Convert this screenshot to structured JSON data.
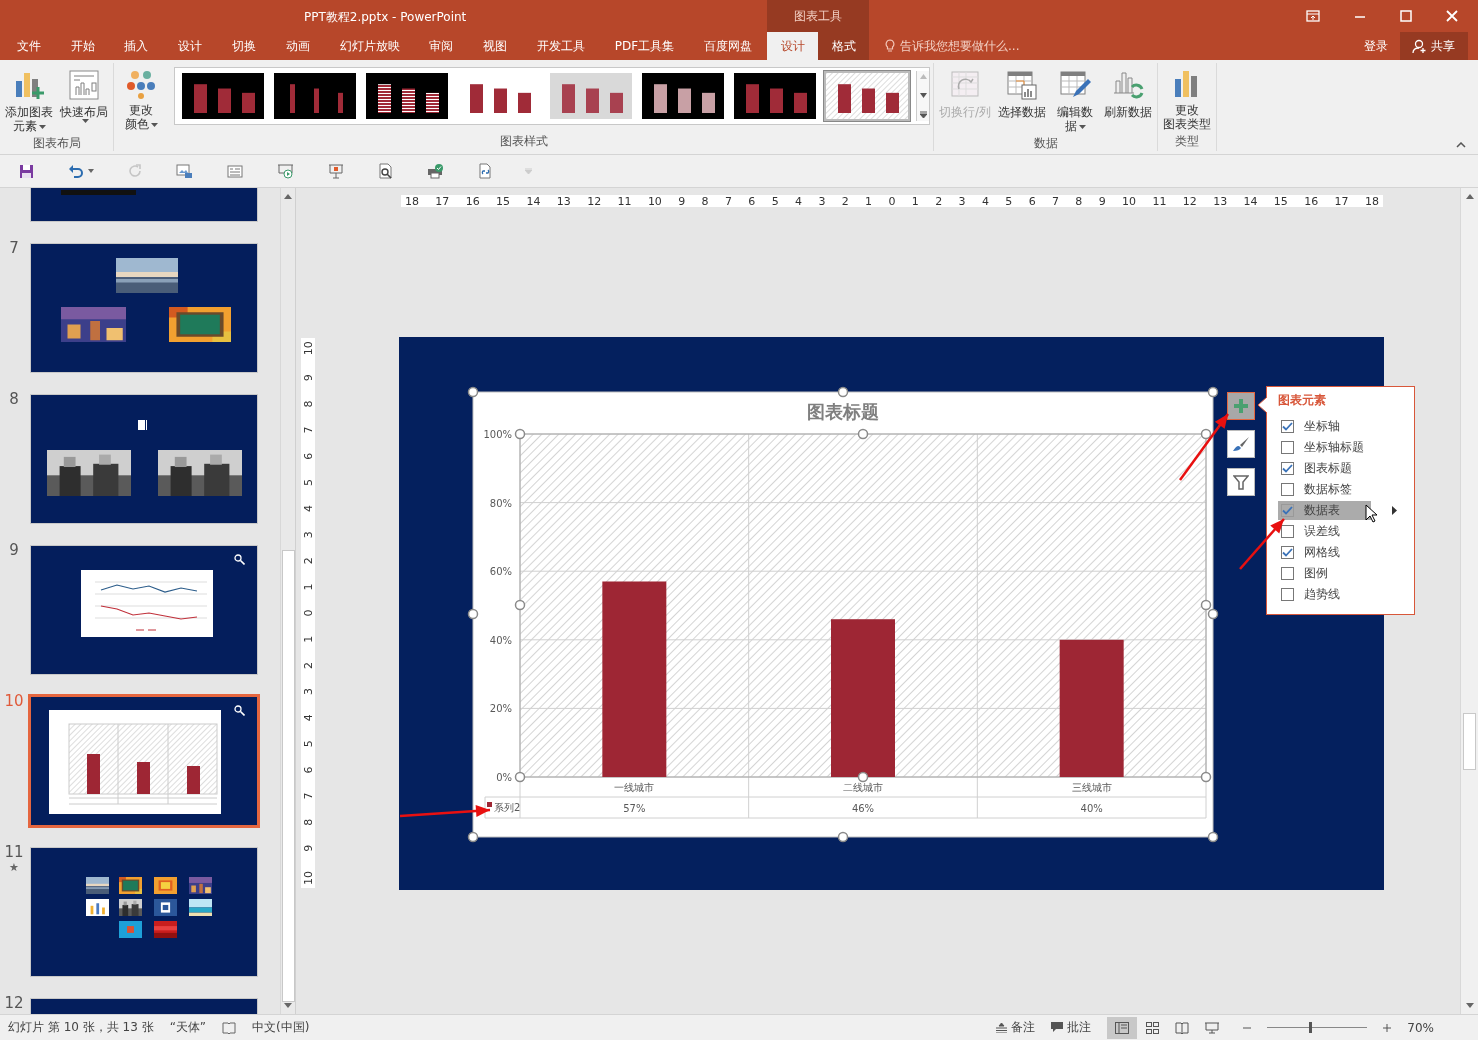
{
  "window": {
    "title": "PPT教程2.pptx - PowerPoint",
    "context_label": "图表工具"
  },
  "tabs": [
    {
      "label": "文件",
      "selected": false,
      "contextual": false
    },
    {
      "label": "开始",
      "selected": false,
      "contextual": false
    },
    {
      "label": "插入",
      "selected": false,
      "contextual": false
    },
    {
      "label": "设计",
      "selected": false,
      "contextual": false
    },
    {
      "label": "切换",
      "selected": false,
      "contextual": false
    },
    {
      "label": "动画",
      "selected": false,
      "contextual": false
    },
    {
      "label": "幻灯片放映",
      "selected": false,
      "contextual": false
    },
    {
      "label": "审阅",
      "selected": false,
      "contextual": false
    },
    {
      "label": "视图",
      "selected": false,
      "contextual": false
    },
    {
      "label": "开发工具",
      "selected": false,
      "contextual": false
    },
    {
      "label": "PDF工具集",
      "selected": false,
      "contextual": false
    },
    {
      "label": "百度网盘",
      "selected": false,
      "contextual": false
    },
    {
      "label": "设计",
      "selected": true,
      "contextual": true
    },
    {
      "label": "格式",
      "selected": false,
      "contextual": true
    }
  ],
  "tell_me": {
    "placeholder": "告诉我您想要做什么..."
  },
  "account": {
    "sign_in": "登录",
    "share": "共享"
  },
  "ribbon": {
    "groups": [
      {
        "label": "图表布局",
        "buttons": [
          {
            "kind": "add-element",
            "lines": [
              "添加图表",
              "元素"
            ],
            "dropdown": true,
            "disabled": false
          },
          {
            "kind": "quick-layout",
            "lines": [
              "快速布局"
            ],
            "dropdown": true,
            "disabled": false
          }
        ]
      },
      {
        "label": "图表样式",
        "buttons": [
          {
            "kind": "colors",
            "lines": [
              "更改",
              "颜色"
            ],
            "dropdown": true,
            "disabled": false
          }
        ],
        "gallery": [
          {
            "kind": "dark",
            "selected": false
          },
          {
            "kind": "dark-thin",
            "selected": false
          },
          {
            "kind": "dark-striped",
            "selected": false
          },
          {
            "kind": "light",
            "selected": false
          },
          {
            "kind": "gray",
            "selected": false
          },
          {
            "kind": "dark-faded",
            "selected": false
          },
          {
            "kind": "dark",
            "selected": false
          },
          {
            "kind": "hatched",
            "selected": true
          }
        ]
      },
      {
        "label": "数据",
        "buttons": [
          {
            "kind": "switch",
            "lines": [
              "切换行/列"
            ],
            "dropdown": false,
            "disabled": true
          },
          {
            "kind": "select-data",
            "lines": [
              "选择数据"
            ],
            "dropdown": false,
            "disabled": false
          },
          {
            "kind": "edit-data",
            "lines": [
              "编辑数",
              "据"
            ],
            "dropdown": true,
            "disabled": false
          },
          {
            "kind": "refresh",
            "lines": [
              "刷新数据"
            ],
            "dropdown": false,
            "disabled": false
          }
        ]
      },
      {
        "label": "类型",
        "buttons": [
          {
            "kind": "chart-type",
            "lines": [
              "更改",
              "图表类型"
            ],
            "dropdown": false,
            "disabled": false
          }
        ]
      }
    ]
  },
  "quick_access": [
    {
      "kind": "save",
      "dropdown": false,
      "disabled": false
    },
    {
      "kind": "undo",
      "dropdown": true,
      "disabled": false
    },
    {
      "kind": "redo",
      "dropdown": false,
      "disabled": true
    },
    {
      "kind": "picture",
      "dropdown": false,
      "disabled": false
    },
    {
      "kind": "text-box",
      "dropdown": false,
      "disabled": false
    },
    {
      "kind": "slideshow",
      "dropdown": false,
      "disabled": false
    },
    {
      "kind": "presenter",
      "dropdown": false,
      "disabled": false
    },
    {
      "kind": "preview",
      "dropdown": false,
      "disabled": false
    },
    {
      "kind": "print",
      "dropdown": false,
      "disabled": false
    },
    {
      "kind": "link",
      "dropdown": false,
      "disabled": false
    }
  ],
  "slides": [
    {
      "kind": "partial-top",
      "selected": false
    },
    {
      "number": "7",
      "kind": "photos",
      "selected": false
    },
    {
      "number": "8",
      "kind": "people",
      "selected": false
    },
    {
      "number": "9",
      "kind": "line-chart",
      "selected": false
    },
    {
      "number": "10",
      "kind": "bar-chart",
      "selected": true
    },
    {
      "number": "11",
      "marker": "★",
      "kind": "collage",
      "selected": false
    },
    {
      "number": "12",
      "kind": "partial-bottom",
      "selected": false
    }
  ],
  "rulers": {
    "horizontal": [
      "18",
      "17",
      "16",
      "15",
      "14",
      "13",
      "12",
      "11",
      "10",
      "9",
      "8",
      "7",
      "6",
      "5",
      "4",
      "3",
      "2",
      "1",
      "0",
      "1",
      "2",
      "3",
      "4",
      "5",
      "6",
      "7",
      "8",
      "9",
      "10",
      "11",
      "12",
      "13",
      "14",
      "15",
      "16",
      "17",
      "18"
    ],
    "vertical": [
      "10",
      "9",
      "8",
      "7",
      "6",
      "5",
      "4",
      "3",
      "2",
      "1",
      "0",
      "1",
      "2",
      "3",
      "4",
      "5",
      "6",
      "7",
      "8",
      "9",
      "10"
    ]
  },
  "chart": {
    "chart_data": {
      "type": "bar",
      "grid": true,
      "title": "图表标题",
      "categories": [
        "一线城市",
        "二线城市",
        "三线城市"
      ],
      "series": [
        {
          "name": "系列2",
          "color": "#9e2634",
          "values": [
            0.57,
            0.46,
            0.4
          ]
        }
      ],
      "ylim": [
        0,
        1
      ],
      "yticks": [
        {
          "value": 0,
          "label": "0%"
        },
        {
          "value": 0.2,
          "label": "20%"
        },
        {
          "value": 0.4,
          "label": "40%"
        },
        {
          "value": 0.6,
          "label": "60%"
        },
        {
          "value": 0.8,
          "label": "80%"
        },
        {
          "value": 1,
          "label": "100%"
        }
      ]
    },
    "data_table": {
      "values": [
        "57%",
        "46%",
        "40%"
      ]
    }
  },
  "chart_tools": [
    {
      "kind": "elements",
      "selected": true
    },
    {
      "kind": "styles",
      "selected": false
    },
    {
      "kind": "filters",
      "selected": false
    }
  ],
  "elements_panel": {
    "title": "图表元素",
    "items": [
      {
        "label": "坐标轴",
        "checked": true,
        "highlighted": false
      },
      {
        "label": "坐标轴标题",
        "checked": false,
        "highlighted": false
      },
      {
        "label": "图表标题",
        "checked": true,
        "highlighted": false
      },
      {
        "label": "数据标签",
        "checked": false,
        "highlighted": false
      },
      {
        "label": "数据表",
        "checked": true,
        "highlighted": true
      },
      {
        "label": "误差线",
        "checked": false,
        "highlighted": false
      },
      {
        "label": "网格线",
        "checked": true,
        "highlighted": false
      },
      {
        "label": "图例",
        "checked": false,
        "highlighted": false
      },
      {
        "label": "趋势线",
        "checked": false,
        "highlighted": false
      }
    ]
  },
  "status_bar": {
    "slide_info": "幻灯片 第 10 张，共 13 张",
    "theme": "“天体”",
    "language": "中文(中国)",
    "notes": "备注",
    "comments": "批注",
    "views": [
      {
        "kind": "normal",
        "selected": true
      },
      {
        "kind": "sorter",
        "selected": false
      },
      {
        "kind": "reading",
        "selected": false
      },
      {
        "kind": "slideshow",
        "selected": false
      }
    ],
    "zoom": {
      "level": 0.42,
      "reading": "70%"
    }
  }
}
